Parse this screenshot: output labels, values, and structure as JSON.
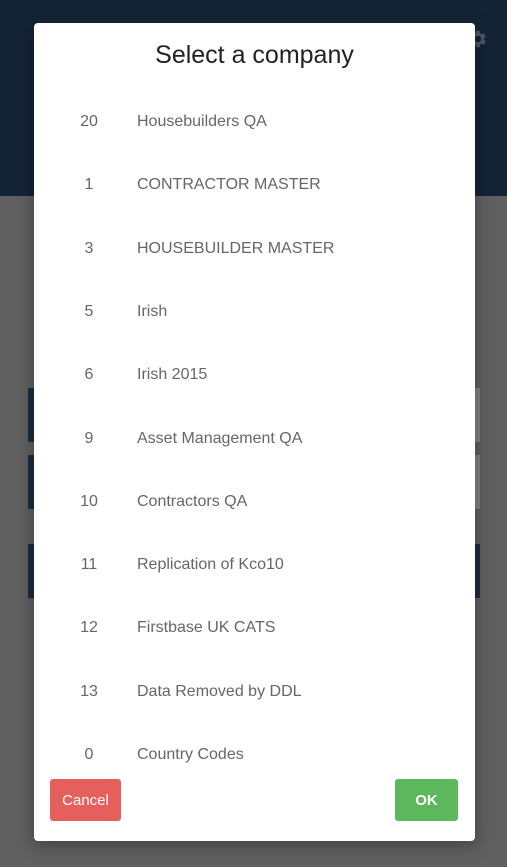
{
  "dialog": {
    "title": "Select a company",
    "companies": [
      {
        "id": "20",
        "name": "Housebuilders QA"
      },
      {
        "id": "1",
        "name": "CONTRACTOR MASTER"
      },
      {
        "id": "3",
        "name": "HOUSEBUILDER MASTER"
      },
      {
        "id": "5",
        "name": "Irish"
      },
      {
        "id": "6",
        "name": "Irish 2015"
      },
      {
        "id": "9",
        "name": "Asset Management QA"
      },
      {
        "id": "10",
        "name": "Contractors QA"
      },
      {
        "id": "11",
        "name": "Replication of Kco10"
      },
      {
        "id": "12",
        "name": "Firstbase UK CATS"
      },
      {
        "id": "13",
        "name": "Data Removed by DDL"
      },
      {
        "id": "0",
        "name": "Country Codes"
      }
    ],
    "cancel_label": "Cancel",
    "ok_label": "OK"
  },
  "colors": {
    "header": "#1f3b57",
    "cancel": "#e5605c",
    "ok": "#5cb85c"
  },
  "icons": {
    "settings": "gear-icon"
  }
}
